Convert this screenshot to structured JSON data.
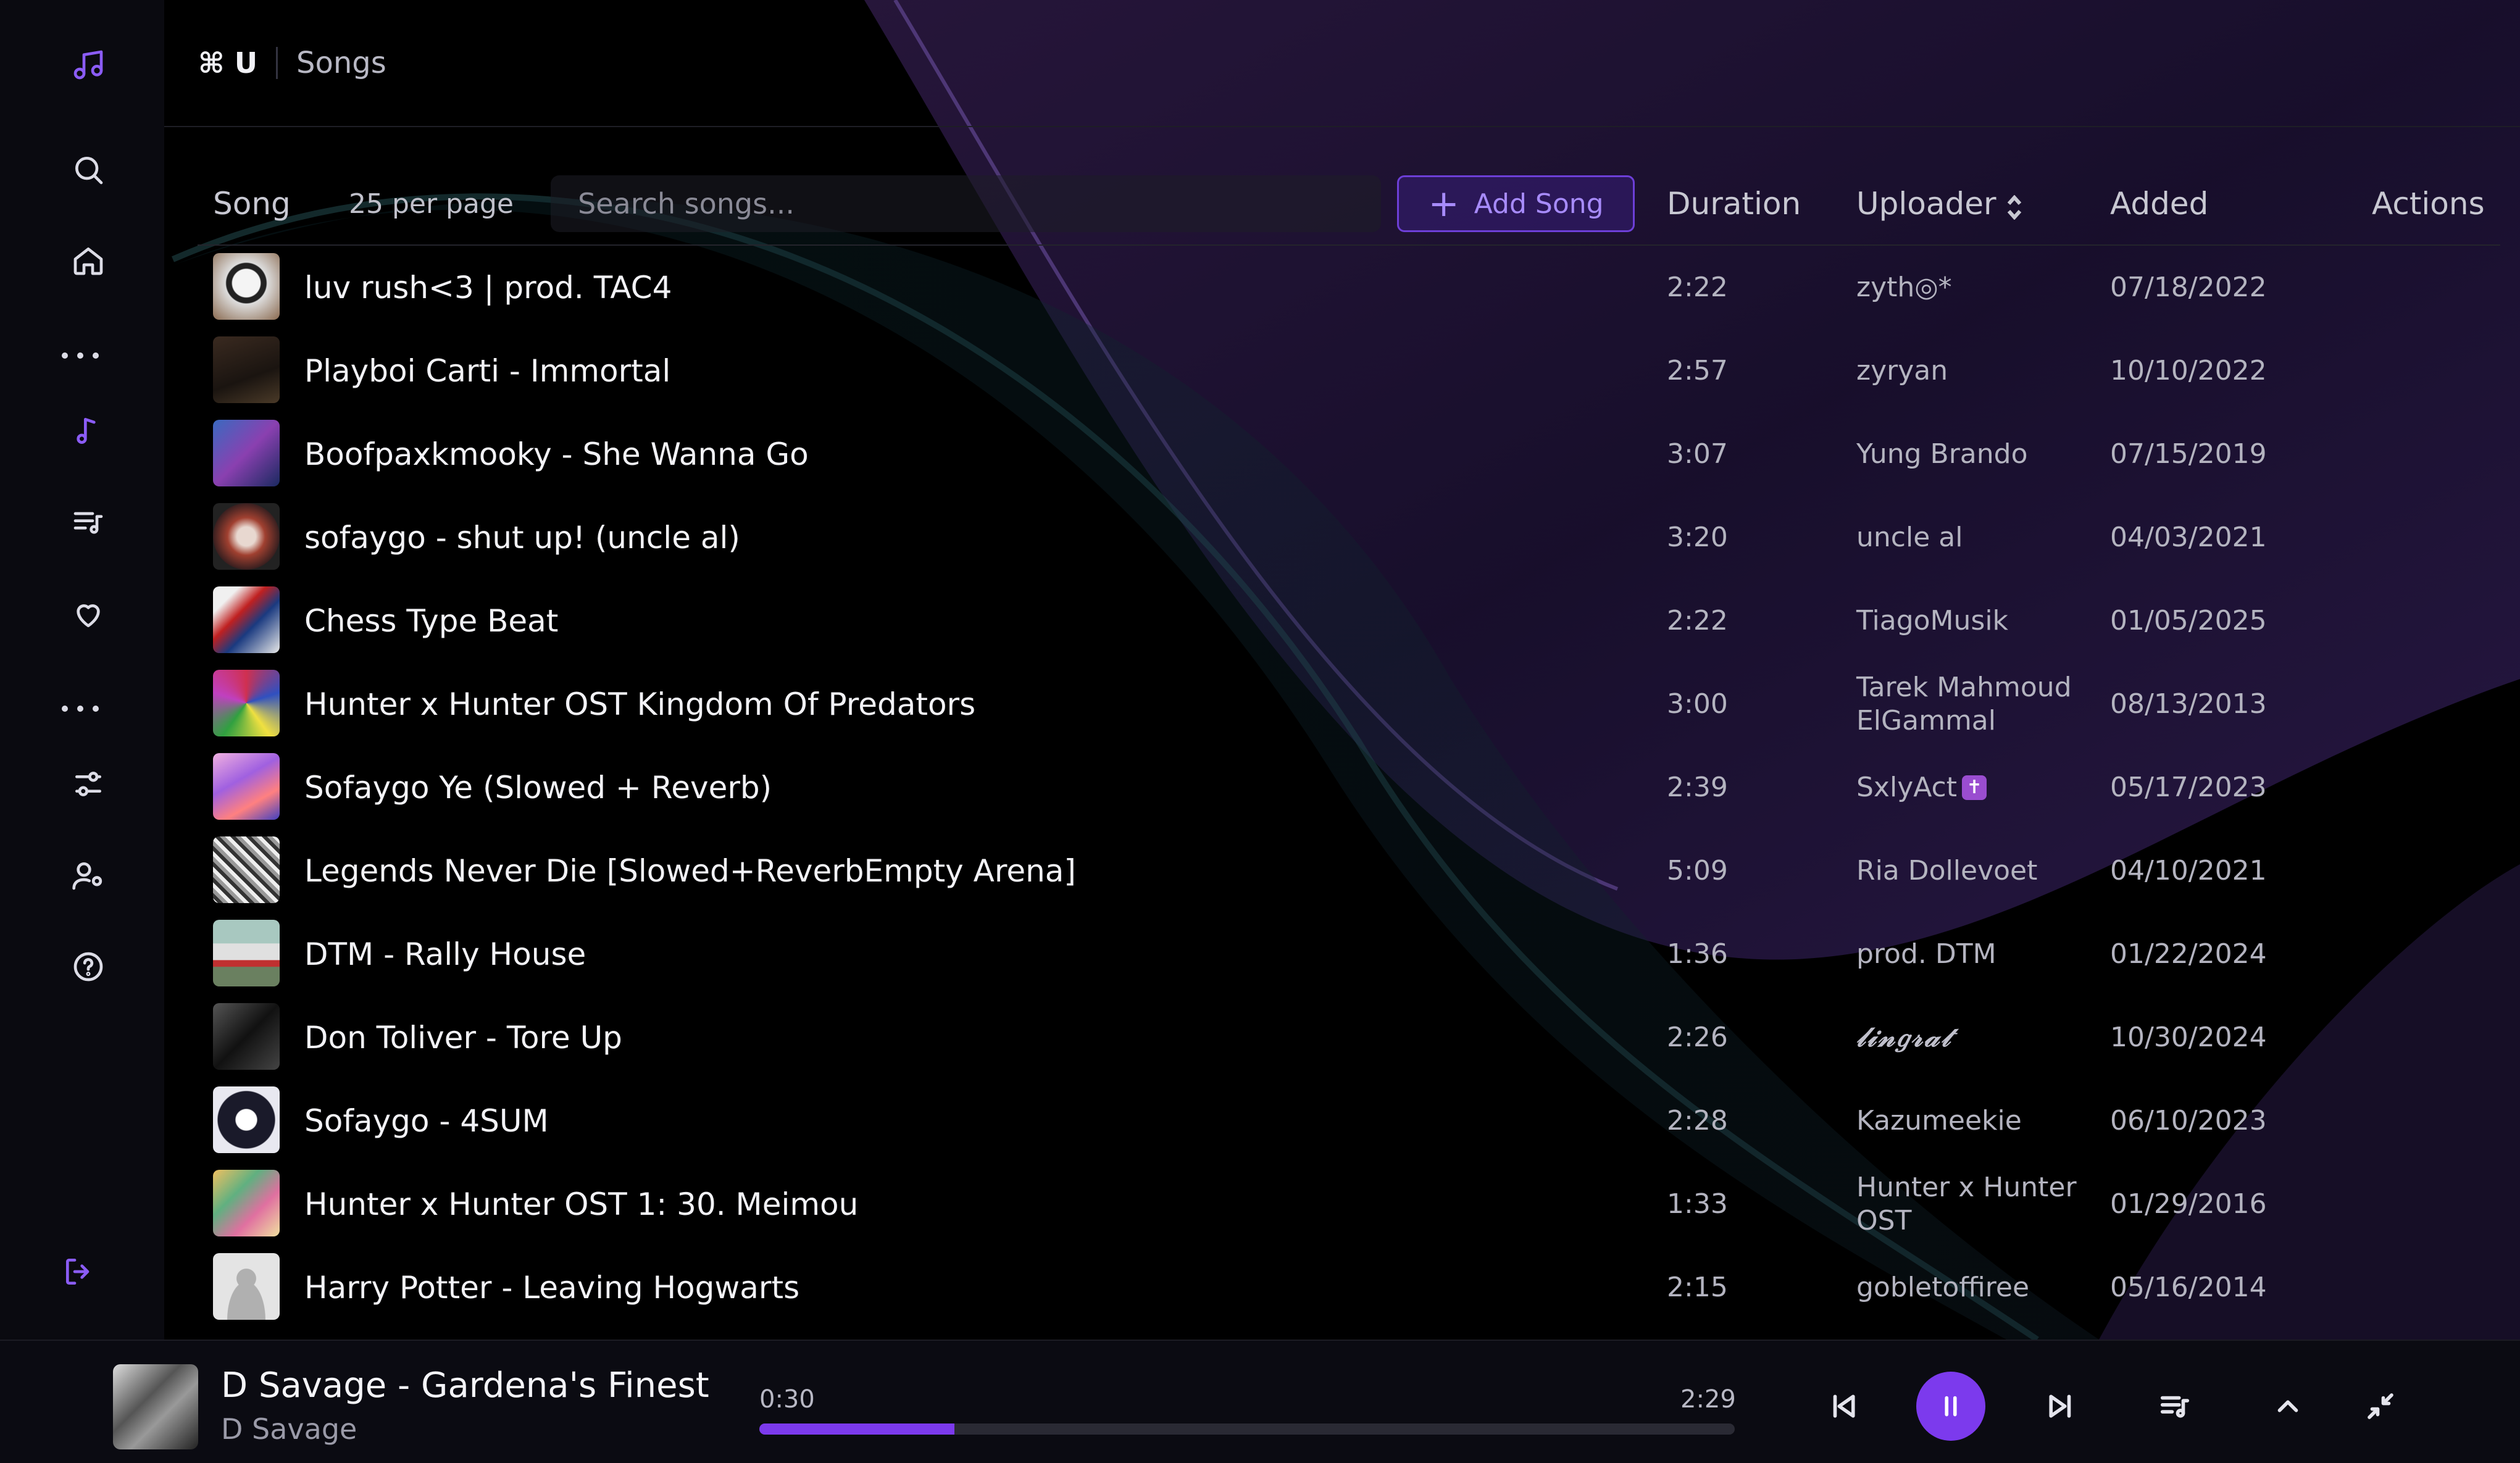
{
  "header": {
    "shortcut": "⌘ U",
    "title": "Songs"
  },
  "toolbar": {
    "song_header": "Song",
    "per_page": "25 per page",
    "search_placeholder": "Search songs...",
    "add_song_label": "Add Song",
    "duration_header": "Duration",
    "uploader_header": "Uploader",
    "added_header": "Added",
    "actions_header": "Actions"
  },
  "songs": [
    {
      "title": "luv rush<3 | prod. TAC4",
      "duration": "2:22",
      "uploader": "zyth◎*",
      "added": "07/18/2022"
    },
    {
      "title": "Playboi Carti - Immortal",
      "duration": "2:57",
      "uploader": "zyryan",
      "added": "10/10/2022"
    },
    {
      "title": "Boofpaxkmooky - She Wanna Go",
      "duration": "3:07",
      "uploader": "Yung Brando",
      "added": "07/15/2019"
    },
    {
      "title": "sofaygo - shut up! (uncle al)",
      "duration": "3:20",
      "uploader": "uncle al",
      "added": "04/03/2021"
    },
    {
      "title": "Chess Type Beat",
      "duration": "2:22",
      "uploader": "TiagoMusik",
      "added": "01/05/2025"
    },
    {
      "title": "Hunter x Hunter OST Kingdom Of Predators",
      "duration": "3:00",
      "uploader": "Tarek Mahmoud ElGammal",
      "added": "08/13/2013"
    },
    {
      "title": "Sofaygo Ye (Slowed + Reverb)",
      "duration": "2:39",
      "uploader": "SxlyAct",
      "added": "05/17/2023"
    },
    {
      "title": "Legends Never Die [Slowed+ReverbEmpty Arena]",
      "duration": "5:09",
      "uploader": "Ria Dollevoet",
      "added": "04/10/2021"
    },
    {
      "title": "DTM - Rally House",
      "duration": "1:36",
      "uploader": "prod. DTM",
      "added": "01/22/2024"
    },
    {
      "title": "Don Toliver - Tore Up",
      "duration": "2:26",
      "uploader": "𝓁𝒾𝓃𝑔𝓇𝒶𝓉",
      "added": "10/30/2024"
    },
    {
      "title": "Sofaygo - 4SUM",
      "duration": "2:28",
      "uploader": "Kazumeekie",
      "added": "06/10/2023"
    },
    {
      "title": "Hunter x Hunter OST 1: 30. Meimou",
      "duration": "1:33",
      "uploader": "Hunter x Hunter OST",
      "added": "01/29/2016"
    },
    {
      "title": "Harry Potter - Leaving Hogwarts",
      "duration": "2:15",
      "uploader": "gobletoffiree",
      "added": "05/16/2014"
    }
  ],
  "player": {
    "title": "D Savage - Gardena's Finest",
    "artist": "D Savage",
    "current_time": "0:30",
    "total_time": "2:29",
    "progress": 0.2
  },
  "colors": {
    "accent": "#7c3aed",
    "background": "#000000",
    "sidebar": "#0a0a10"
  }
}
